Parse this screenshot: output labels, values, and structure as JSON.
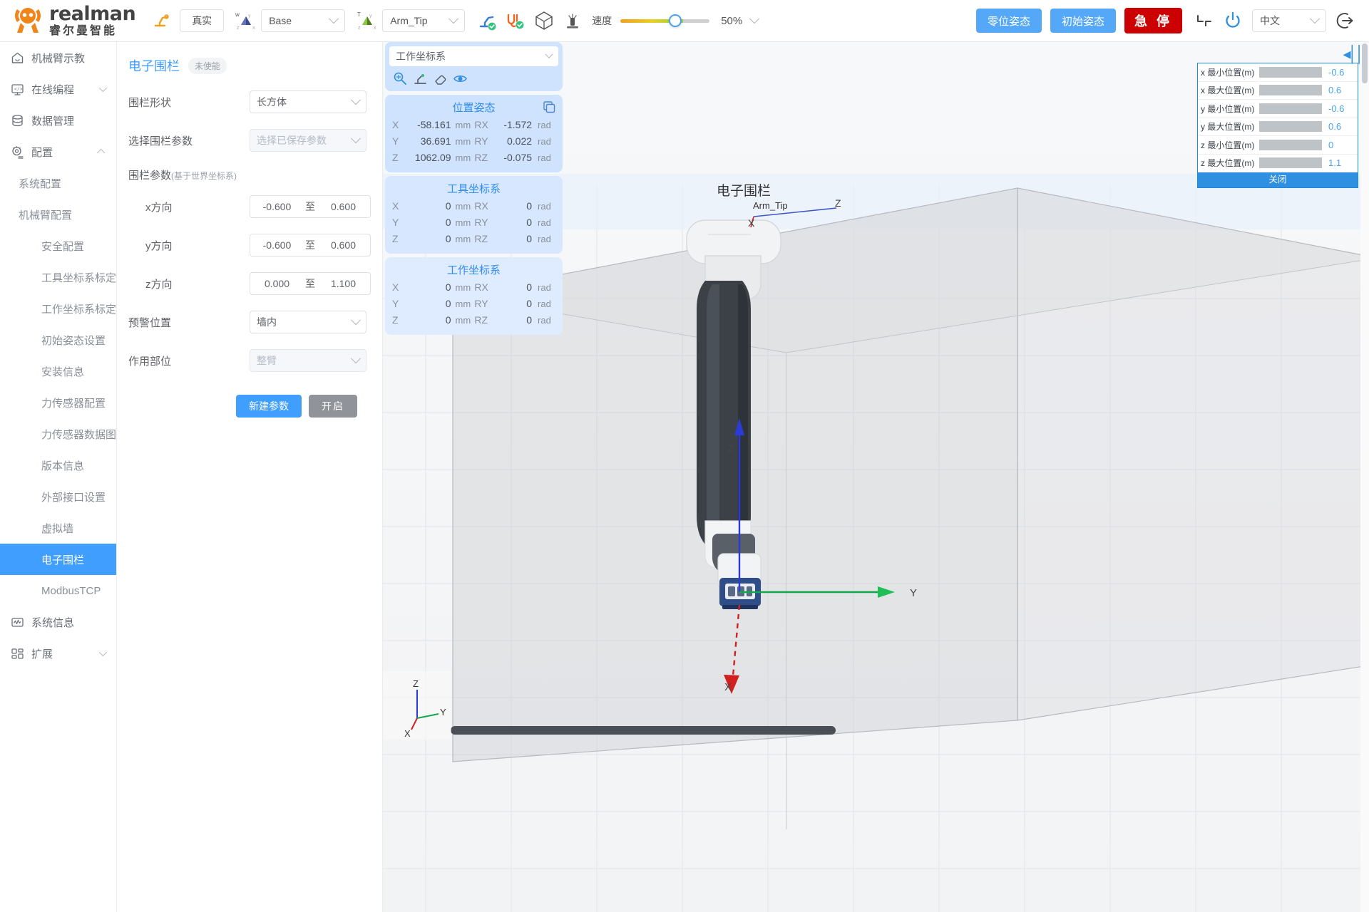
{
  "header": {
    "brand_en": "realman",
    "brand_cn": "睿尔曼智能",
    "teach_icon": "robot-arm-teach-icon",
    "mode_button": "真实",
    "base_frame_icon": "world-axis-icon",
    "base_frame_value": "Base",
    "tool_frame_icon": "tool-axis-icon",
    "tool_frame_value": "Arm_Tip",
    "status_icons": [
      "arm-connected-icon",
      "cable-connected-icon",
      "collision-box-icon",
      "drag-teach-icon"
    ],
    "speed_label": "速度",
    "speed_value": "50%",
    "zero_pose_button": "零位姿态",
    "init_pose_button": "初始姿态",
    "estop_button": "急 停",
    "fold_icon": "fold-arm-icon",
    "power_icon": "power-icon",
    "language_value": "中文",
    "logout_icon": "logout-icon"
  },
  "sidebar": {
    "items": [
      {
        "label": "机械臂示教",
        "icon": "home-icon",
        "level": 1,
        "arrow": "none",
        "active": false
      },
      {
        "label": "在线编程",
        "icon": "code-icon",
        "level": 1,
        "arrow": "down",
        "active": false
      },
      {
        "label": "数据管理",
        "icon": "database-icon",
        "level": 1,
        "arrow": "none",
        "active": false
      },
      {
        "label": "配置",
        "icon": "gear-icon",
        "level": 1,
        "arrow": "up",
        "active": false
      },
      {
        "label": "系统配置",
        "icon": "",
        "level": 2,
        "arrow": "down",
        "active": false
      },
      {
        "label": "机械臂配置",
        "icon": "",
        "level": 2,
        "arrow": "up",
        "active": false
      },
      {
        "label": "安全配置",
        "icon": "",
        "level": 3,
        "arrow": "none",
        "active": false
      },
      {
        "label": "工具坐标系标定",
        "icon": "",
        "level": 3,
        "arrow": "none",
        "active": false
      },
      {
        "label": "工作坐标系标定",
        "icon": "",
        "level": 3,
        "arrow": "none",
        "active": false
      },
      {
        "label": "初始姿态设置",
        "icon": "",
        "level": 3,
        "arrow": "none",
        "active": false
      },
      {
        "label": "安装信息",
        "icon": "",
        "level": 3,
        "arrow": "none",
        "active": false
      },
      {
        "label": "力传感器配置",
        "icon": "",
        "level": 3,
        "arrow": "none",
        "active": false
      },
      {
        "label": "力传感器数据图",
        "icon": "",
        "level": 3,
        "arrow": "none",
        "active": false
      },
      {
        "label": "版本信息",
        "icon": "",
        "level": 3,
        "arrow": "none",
        "active": false
      },
      {
        "label": "外部接口设置",
        "icon": "",
        "level": 3,
        "arrow": "none",
        "active": false
      },
      {
        "label": "虚拟墙",
        "icon": "",
        "level": 3,
        "arrow": "none",
        "active": false
      },
      {
        "label": "电子围栏",
        "icon": "",
        "level": 3,
        "arrow": "none",
        "active": true
      },
      {
        "label": "ModbusTCP",
        "icon": "",
        "level": 3,
        "arrow": "none",
        "active": false
      },
      {
        "label": "系统信息",
        "icon": "monitor-wave-icon",
        "level": 1,
        "arrow": "none",
        "active": false
      },
      {
        "label": "扩展",
        "icon": "grid-icon",
        "level": 1,
        "arrow": "down",
        "active": false
      }
    ]
  },
  "form": {
    "title": "电子围栏",
    "status_badge": "未使能",
    "shape_label": "围栏形状",
    "shape_value": "长方体",
    "param_select_label": "选择围栏参数",
    "param_select_placeholder": "选择已保存参数",
    "params_label": "围栏参数",
    "params_label_note": "(基于世界坐标系)",
    "ranges": [
      {
        "label": "x方向",
        "min": "-0.600",
        "sep": "至",
        "max": "0.600"
      },
      {
        "label": "y方向",
        "min": "-0.600",
        "sep": "至",
        "max": "0.600"
      },
      {
        "label": "z方向",
        "min": "0.000",
        "sep": "至",
        "max": "1.100"
      }
    ],
    "warn_pos_label": "预警位置",
    "warn_pos_value": "墙内",
    "act_part_label": "作用部位",
    "act_part_value": "整臂",
    "new_param_button": "新建参数",
    "enable_button": "开启"
  },
  "viewport": {
    "frame_select_value": "工作坐标系",
    "toolbar_icons": [
      "magnifier-axis-icon",
      "move-to-icon",
      "eraser-icon",
      "eye-visible-icon"
    ],
    "collapse_icon": "collapse-panel-icon",
    "labels_3d": {
      "fence_label": "电子围栏",
      "tool_label": "Arm_Tip",
      "axis_x": "X",
      "axis_y": "Y",
      "axis_z": "Z"
    },
    "gizmo": {
      "x": "X",
      "y": "Y",
      "z": "Z"
    },
    "cards": [
      {
        "title": "位置姿态",
        "copy_icon": "copy-icon",
        "rows": [
          {
            "axis": "X",
            "value": "-58.161",
            "unit": "mm",
            "axis2": "RX",
            "value2": "-1.572",
            "unit2": "rad"
          },
          {
            "axis": "Y",
            "value": "36.691",
            "unit": "mm",
            "axis2": "RY",
            "value2": "0.022",
            "unit2": "rad"
          },
          {
            "axis": "Z",
            "value": "1062.09",
            "unit": "mm",
            "axis2": "RZ",
            "value2": "-0.075",
            "unit2": "rad"
          }
        ]
      },
      {
        "title": "工具坐标系",
        "copy_icon": "",
        "rows": [
          {
            "axis": "X",
            "value": "0",
            "unit": "mm",
            "axis2": "RX",
            "value2": "0",
            "unit2": "rad"
          },
          {
            "axis": "Y",
            "value": "0",
            "unit": "mm",
            "axis2": "RY",
            "value2": "0",
            "unit2": "rad"
          },
          {
            "axis": "Z",
            "value": "0",
            "unit": "mm",
            "axis2": "RZ",
            "value2": "0",
            "unit2": "rad"
          }
        ]
      },
      {
        "title": "工作坐标系",
        "copy_icon": "",
        "rows": [
          {
            "axis": "X",
            "value": "0",
            "unit": "mm",
            "axis2": "RX",
            "value2": "0",
            "unit2": "rad"
          },
          {
            "axis": "Y",
            "value": "0",
            "unit": "mm",
            "axis2": "RY",
            "value2": "0",
            "unit2": "rad"
          },
          {
            "axis": "Z",
            "value": "0",
            "unit": "mm",
            "axis2": "RZ",
            "value2": "0",
            "unit2": "rad"
          }
        ]
      }
    ],
    "sliders": {
      "rows": [
        {
          "name": "x 最小位置(m)",
          "value": "-0.6",
          "fill_pct": 50
        },
        {
          "name": "x 最大位置(m)",
          "value": "0.6",
          "fill_pct": 55
        },
        {
          "name": "y 最小位置(m)",
          "value": "-0.6",
          "fill_pct": 50
        },
        {
          "name": "y 最大位置(m)",
          "value": "0.6",
          "fill_pct": 55
        },
        {
          "name": "z 最小位置(m)",
          "value": "0",
          "fill_pct": 51
        },
        {
          "name": "z 最大位置(m)",
          "value": "1.1",
          "fill_pct": 63
        }
      ],
      "close_button": "关闭"
    }
  },
  "colors": {
    "accent": "#409eff",
    "danger": "#cc0000",
    "brand_orange": "#f08519",
    "panel_blue": "#cfe3ff"
  }
}
